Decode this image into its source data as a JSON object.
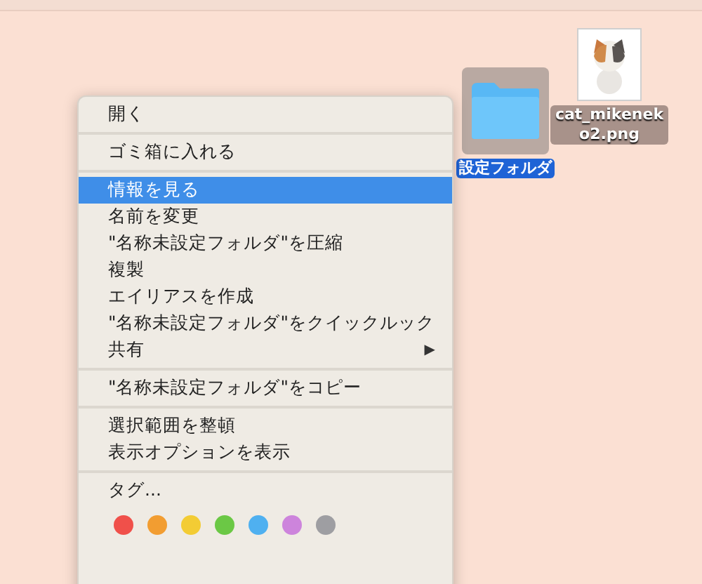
{
  "desktop_icons": [
    {
      "kind": "folder",
      "label": "設定フォルダ",
      "selected": true
    },
    {
      "kind": "image",
      "label": "cat_mikeneko2.png",
      "selected": false
    }
  ],
  "context_menu": {
    "groups": [
      {
        "items": [
          {
            "label": "開く",
            "selected": false
          }
        ]
      },
      {
        "items": [
          {
            "label": "ゴミ箱に入れる",
            "selected": false
          }
        ]
      },
      {
        "items": [
          {
            "label": "情報を見る",
            "selected": true
          },
          {
            "label": "名前を変更",
            "selected": false
          },
          {
            "label": "\"名称未設定フォルダ\"を圧縮",
            "selected": false
          },
          {
            "label": "複製",
            "selected": false
          },
          {
            "label": "エイリアスを作成",
            "selected": false
          },
          {
            "label": "\"名称未設定フォルダ\"をクイックルック",
            "selected": false
          },
          {
            "label": "共有",
            "selected": false,
            "submenu": true,
            "arrow": "▶"
          }
        ]
      },
      {
        "items": [
          {
            "label": "\"名称未設定フォルダ\"をコピー",
            "selected": false
          }
        ]
      },
      {
        "items": [
          {
            "label": "選択範囲を整頓",
            "selected": false
          },
          {
            "label": "表示オプションを表示",
            "selected": false
          }
        ]
      },
      {
        "items": [
          {
            "label": "タグ...",
            "selected": false
          }
        ]
      }
    ],
    "tag_colors": [
      {
        "color": "#f0504a"
      },
      {
        "color": "#f29d31"
      },
      {
        "color": "#f3cc34"
      },
      {
        "color": "#6bc845"
      },
      {
        "color": "#4fb0f0"
      },
      {
        "color": "#cd84dc"
      },
      {
        "color": "#9e9ea2"
      }
    ]
  }
}
